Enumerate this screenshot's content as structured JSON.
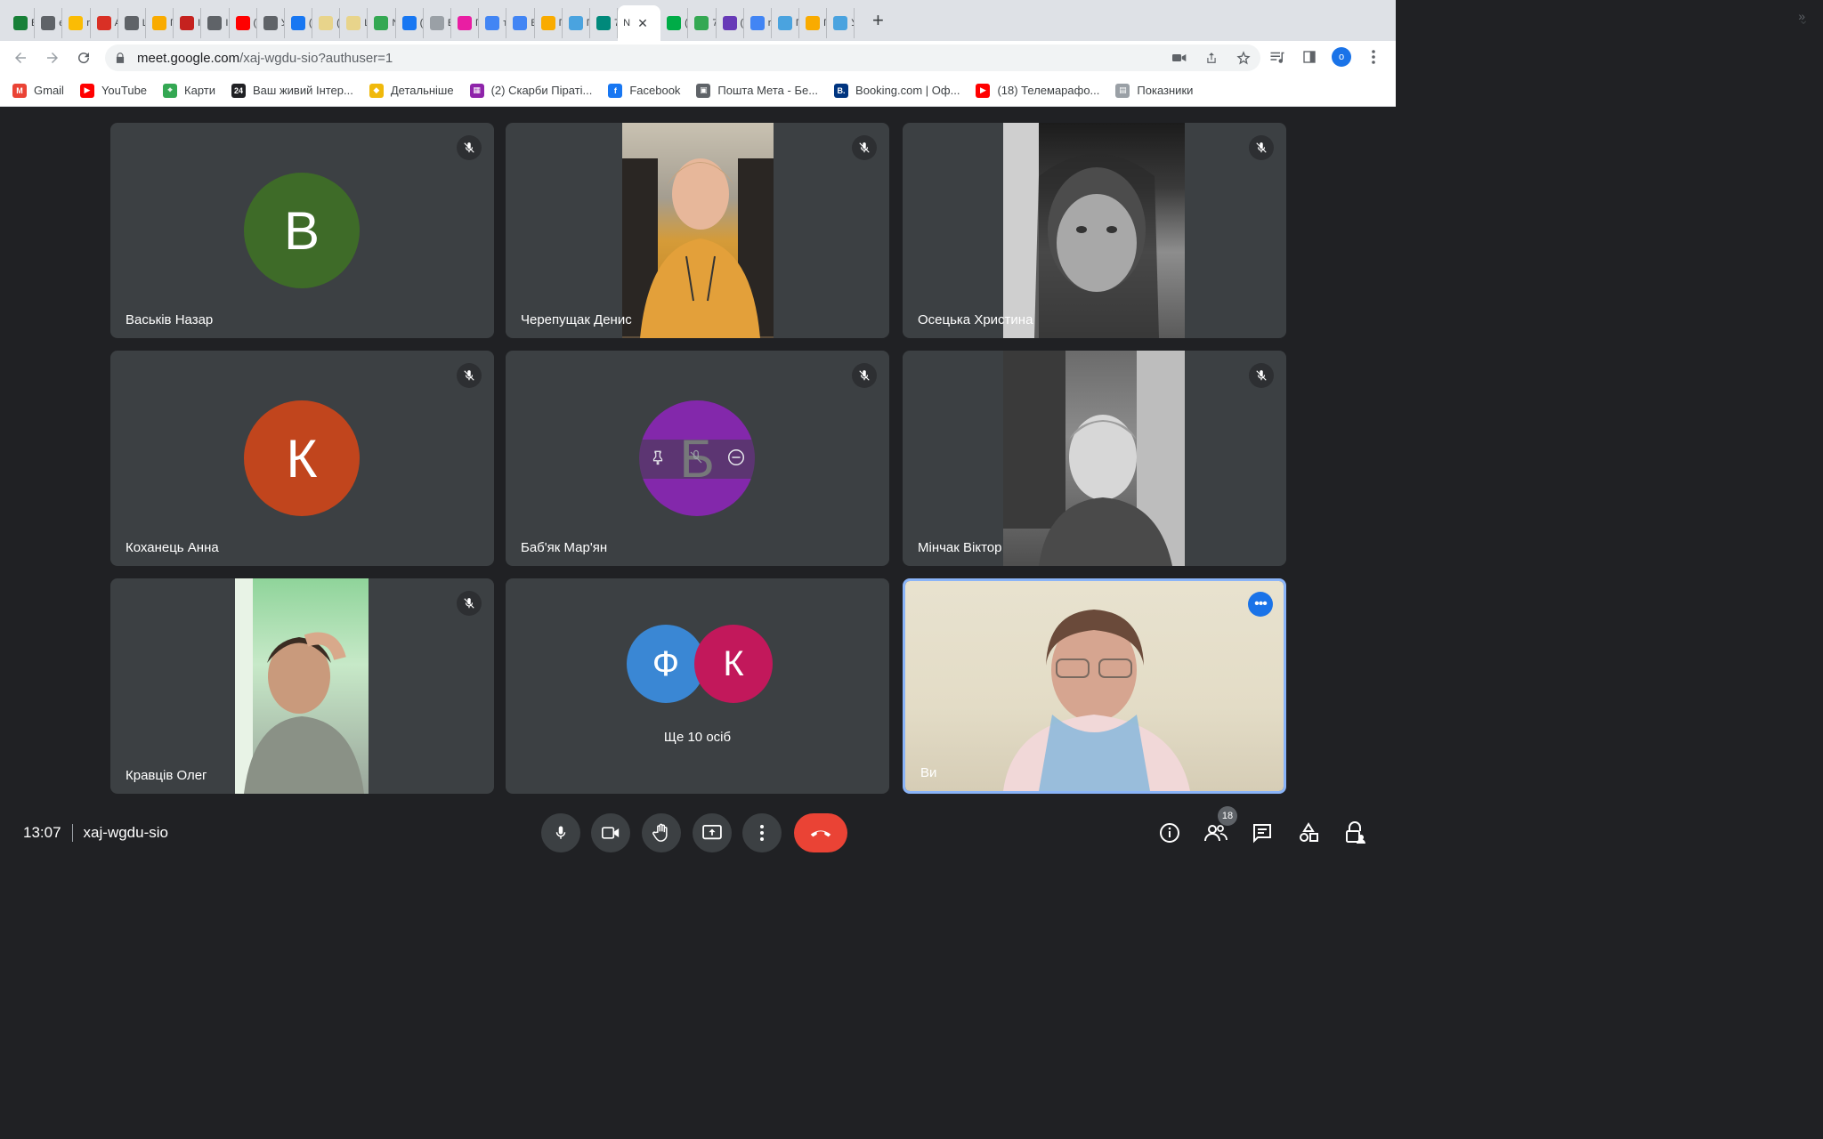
{
  "browser": {
    "tabs": [
      {
        "letter": "E",
        "color": "#188038"
      },
      {
        "letter": "є",
        "color": "#5f6368"
      },
      {
        "letter": "r",
        "color": "#fbbc04"
      },
      {
        "letter": "A",
        "color": "#d93025"
      },
      {
        "letter": "L",
        "color": "#5f6368"
      },
      {
        "letter": "Г",
        "color": "#f9ab00"
      },
      {
        "letter": "I",
        "color": "#c5221f"
      },
      {
        "letter": "I",
        "color": "#5f6368"
      },
      {
        "letter": "(",
        "color": "#ff0000"
      },
      {
        "letter": "У",
        "color": "#5f6368"
      },
      {
        "letter": "(",
        "color": "#1877f2"
      },
      {
        "letter": "(",
        "color": "#e8d48b"
      },
      {
        "letter": "L",
        "color": "#e8d48b"
      },
      {
        "letter": "N",
        "color": "#34a853"
      },
      {
        "letter": "(",
        "color": "#1877f2"
      },
      {
        "letter": "E",
        "color": "#9aa0a6"
      },
      {
        "letter": "Г",
        "color": "#e91ea3"
      },
      {
        "letter": "т",
        "color": "#4285f4"
      },
      {
        "letter": "E",
        "color": "#4285f4"
      },
      {
        "letter": "Г",
        "color": "#f9ab00"
      },
      {
        "letter": "Г",
        "color": "#4aa3df"
      },
      {
        "letter": "7",
        "color": "#00897b"
      }
    ],
    "active_tab": {
      "letter": "N",
      "close": "✕"
    },
    "tabs_after": [
      {
        "letter": "(",
        "color": "#00ac47"
      },
      {
        "letter": "7",
        "color": "#34a853"
      },
      {
        "letter": "(",
        "color": "#673ab7"
      },
      {
        "letter": "r",
        "color": "#4285f4"
      },
      {
        "letter": "Г",
        "color": "#4aa3df"
      },
      {
        "letter": "Г",
        "color": "#f9ab00"
      },
      {
        "letter": "У",
        "color": "#4aa3df"
      }
    ],
    "new_tab": "+",
    "tab_menu": "⌄",
    "url_host": "meet.google.com",
    "url_path": "/xaj-wgdu-sio?authuser=1",
    "profile_initial": "о",
    "bookmarks": [
      {
        "label": "Gmail",
        "color": "#ea4335",
        "glyph": "M"
      },
      {
        "label": "YouTube",
        "color": "#ff0000",
        "glyph": "▶"
      },
      {
        "label": "Карти",
        "color": "#34a853",
        "glyph": "⌖"
      },
      {
        "label": "Ваш живий Інтер...",
        "color": "#202124",
        "glyph": "24"
      },
      {
        "label": "Детальніше",
        "color": "#f0b90b",
        "glyph": "◆"
      },
      {
        "label": "(2) Скарби Піраті...",
        "color": "#8e24aa",
        "glyph": "▦"
      },
      {
        "label": "Facebook",
        "color": "#1877f2",
        "glyph": "f"
      },
      {
        "label": "Пошта Мета - Бе...",
        "color": "#5f6368",
        "glyph": "▣"
      },
      {
        "label": "Booking.com | Оф...",
        "color": "#003580",
        "glyph": "B."
      },
      {
        "label": "(18) Телемарафо...",
        "color": "#ff0000",
        "glyph": "▶"
      },
      {
        "label": "Показники",
        "color": "#9aa0a6",
        "glyph": "▤"
      }
    ],
    "bookmarks_more": "»"
  },
  "meeting": {
    "participants": [
      {
        "name": "Васьків Назар",
        "initial": "В",
        "color": "#3e6b28"
      },
      {
        "name": "Черепущак Денис"
      },
      {
        "name": "Осецька Христина"
      },
      {
        "name": "Коханець Анна",
        "initial": "К",
        "color": "#c1451d"
      },
      {
        "name": "Баб'як Мар'ян",
        "initial": "Б",
        "color": "#8328ab"
      },
      {
        "name": "Мінчак Віктор"
      },
      {
        "name": "Кравців Олег"
      },
      {
        "others_text": "Ще 10 осіб",
        "initials": [
          "Ф",
          "К"
        ],
        "colors": [
          "#3a87d4",
          "#c2185b"
        ]
      },
      {
        "name": "Ви"
      }
    ],
    "time": "13:07",
    "code": "xaj-wgdu-sio",
    "people_count": "18",
    "end_call_color": "#ea4335"
  }
}
